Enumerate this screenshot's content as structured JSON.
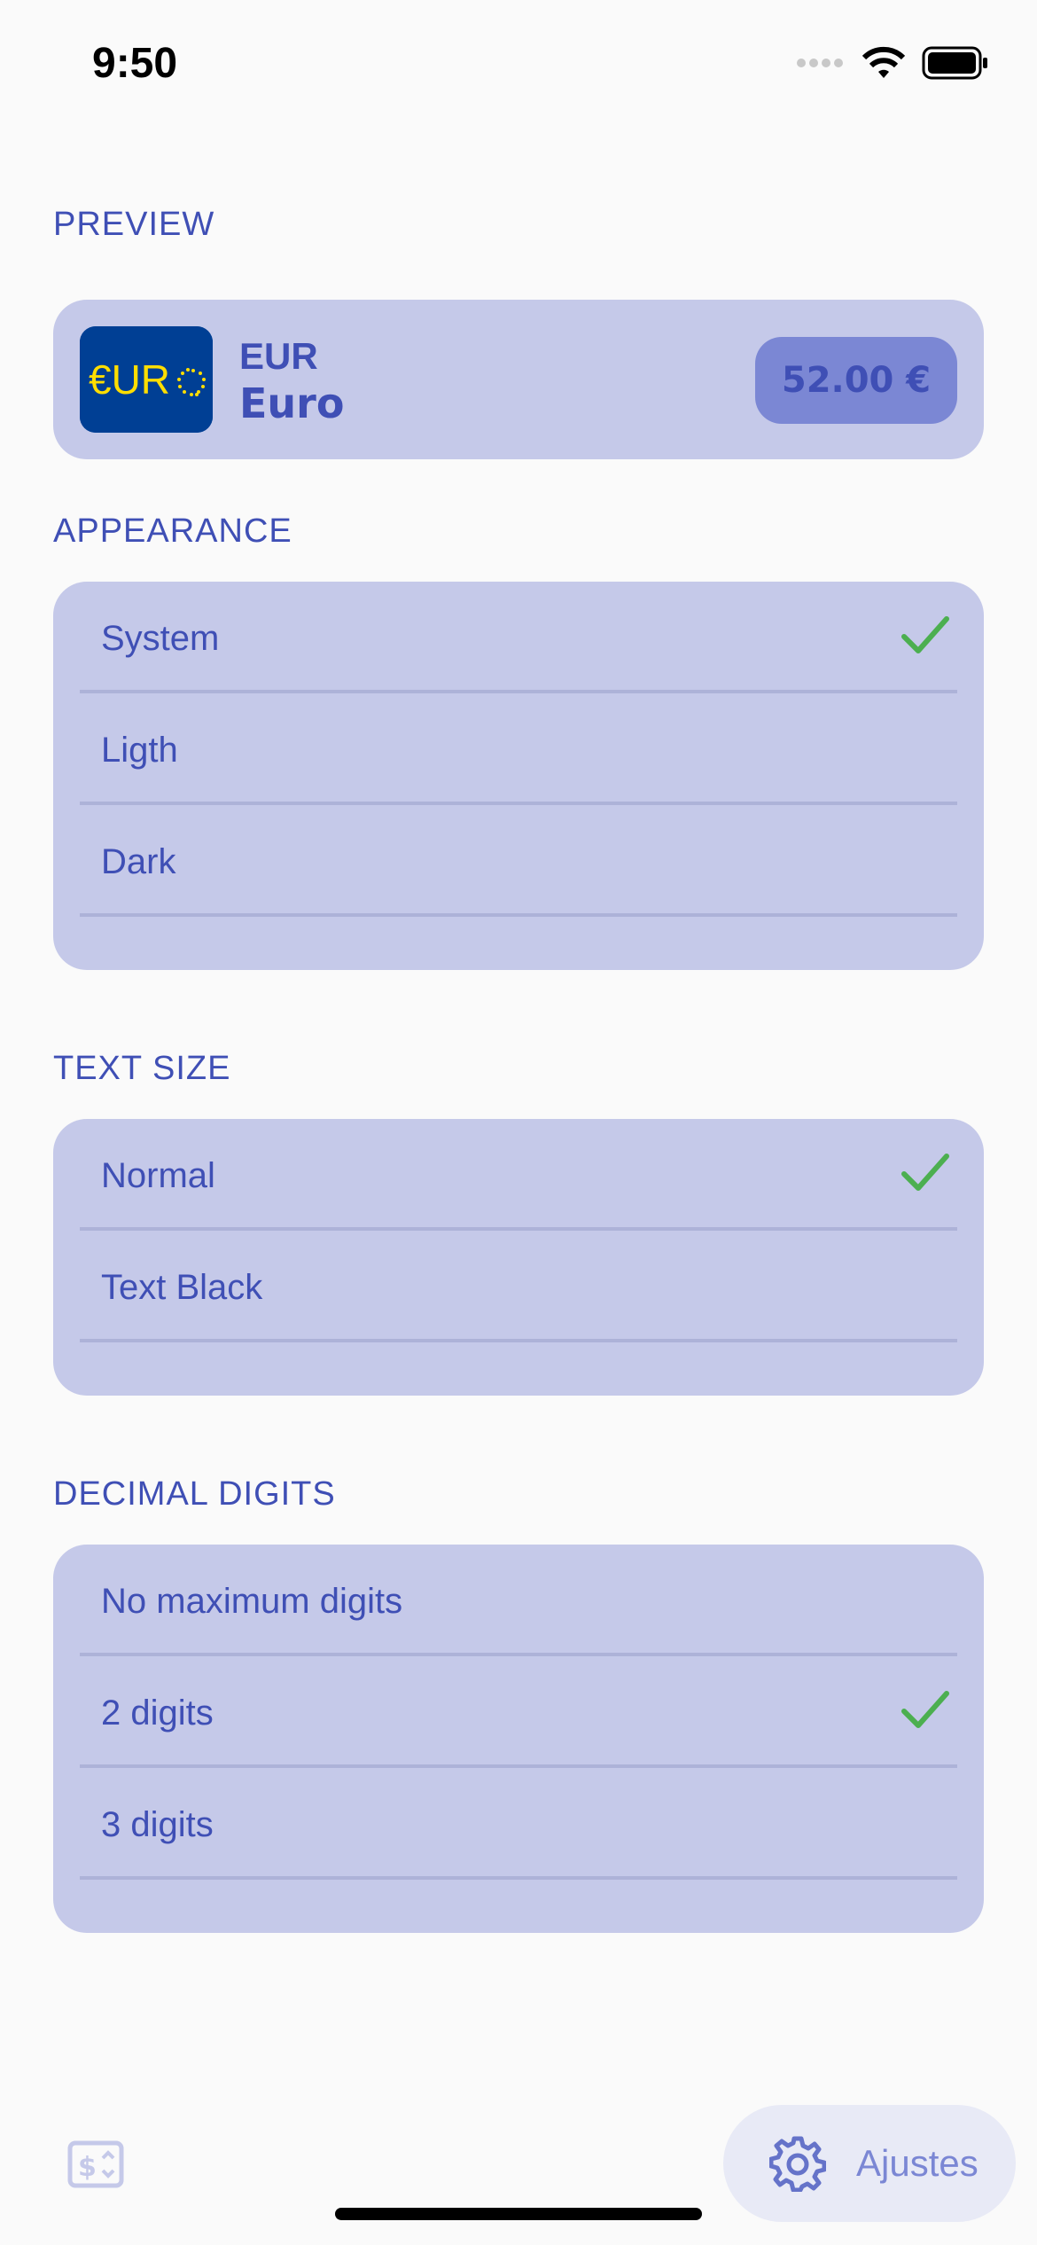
{
  "status_bar": {
    "time": "9:50"
  },
  "preview": {
    "section_title": "PREVIEW",
    "flag_text": "€URO",
    "currency_code": "EUR",
    "currency_name": "Euro",
    "amount": "52.00 €"
  },
  "appearance": {
    "section_title": "APPEARANCE",
    "options": [
      {
        "label": "System",
        "selected": true
      },
      {
        "label": "Ligth",
        "selected": false
      },
      {
        "label": "Dark",
        "selected": false
      }
    ]
  },
  "text_size": {
    "section_title": "TEXT SIZE",
    "options": [
      {
        "label": "Normal",
        "selected": true
      },
      {
        "label": "Text Black",
        "selected": false
      }
    ]
  },
  "decimal_digits": {
    "section_title": "DECIMAL DIGITS",
    "options": [
      {
        "label": "No maximum digits",
        "selected": false
      },
      {
        "label": "2 digits",
        "selected": true
      },
      {
        "label": "3 digits",
        "selected": false
      }
    ]
  },
  "tab_bar": {
    "left_icon": "currency-converter-icon",
    "settings_icon": "gear-icon",
    "settings_label": "Ajustes"
  },
  "colors": {
    "accent": "#3f4fb5",
    "card_bg": "#c5c9e9",
    "check": "#4caf50",
    "flag_bg": "#003f94",
    "flag_text": "#ffde00"
  }
}
